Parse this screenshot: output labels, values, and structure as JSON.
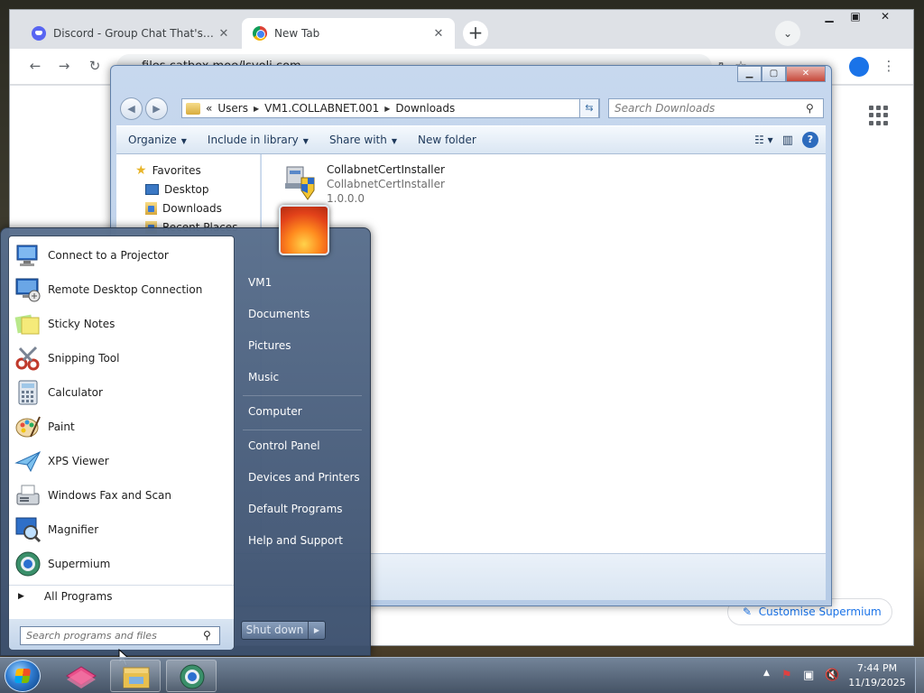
{
  "browser": {
    "tabs": [
      {
        "title": "Discord - Group Chat That's All F",
        "icon": "discord-icon"
      },
      {
        "title": "New Tab",
        "icon": "chrome-icon"
      }
    ],
    "address": "files.catbox.moe/lsvoli.com",
    "customise_label": "Customise Supermium"
  },
  "explorer": {
    "breadcrumb": [
      "«",
      "Users",
      "VM1.COLLABNET.001",
      "Downloads"
    ],
    "search_placeholder": "Search Downloads",
    "commands": [
      "Organize",
      "Include in library",
      "Share with",
      "New folder"
    ],
    "nav": {
      "favorites": "Favorites",
      "desktop": "Desktop",
      "downloads": "Downloads",
      "recent": "Recent Places"
    },
    "file": {
      "name": "CollabnetCertInstaller",
      "description": "CollabnetCertInstaller",
      "version": "1.0.0.0"
    }
  },
  "start_menu": {
    "programs": [
      {
        "label": "Connect to a Projector",
        "icon": "projector-icon"
      },
      {
        "label": "Remote Desktop Connection",
        "icon": "remote-desktop-icon"
      },
      {
        "label": "Sticky Notes",
        "icon": "sticky-notes-icon"
      },
      {
        "label": "Snipping Tool",
        "icon": "scissors-icon"
      },
      {
        "label": "Calculator",
        "icon": "calculator-icon"
      },
      {
        "label": "Paint",
        "icon": "paint-palette-icon"
      },
      {
        "label": "XPS Viewer",
        "icon": "paper-plane-icon"
      },
      {
        "label": "Windows Fax and Scan",
        "icon": "fax-icon"
      },
      {
        "label": "Magnifier",
        "icon": "magnifier-icon"
      },
      {
        "label": "Supermium",
        "icon": "supermium-icon"
      }
    ],
    "all_programs": "All Programs",
    "search_placeholder": "Search programs and files",
    "right_links": [
      "VM1",
      "Documents",
      "Pictures",
      "Music",
      "Computer",
      "Control Panel",
      "Devices and Printers",
      "Default Programs",
      "Help and Support"
    ],
    "shutdown_label": "Shut down"
  },
  "taskbar": {
    "time": "7:44 PM",
    "date": "11/19/2025"
  }
}
